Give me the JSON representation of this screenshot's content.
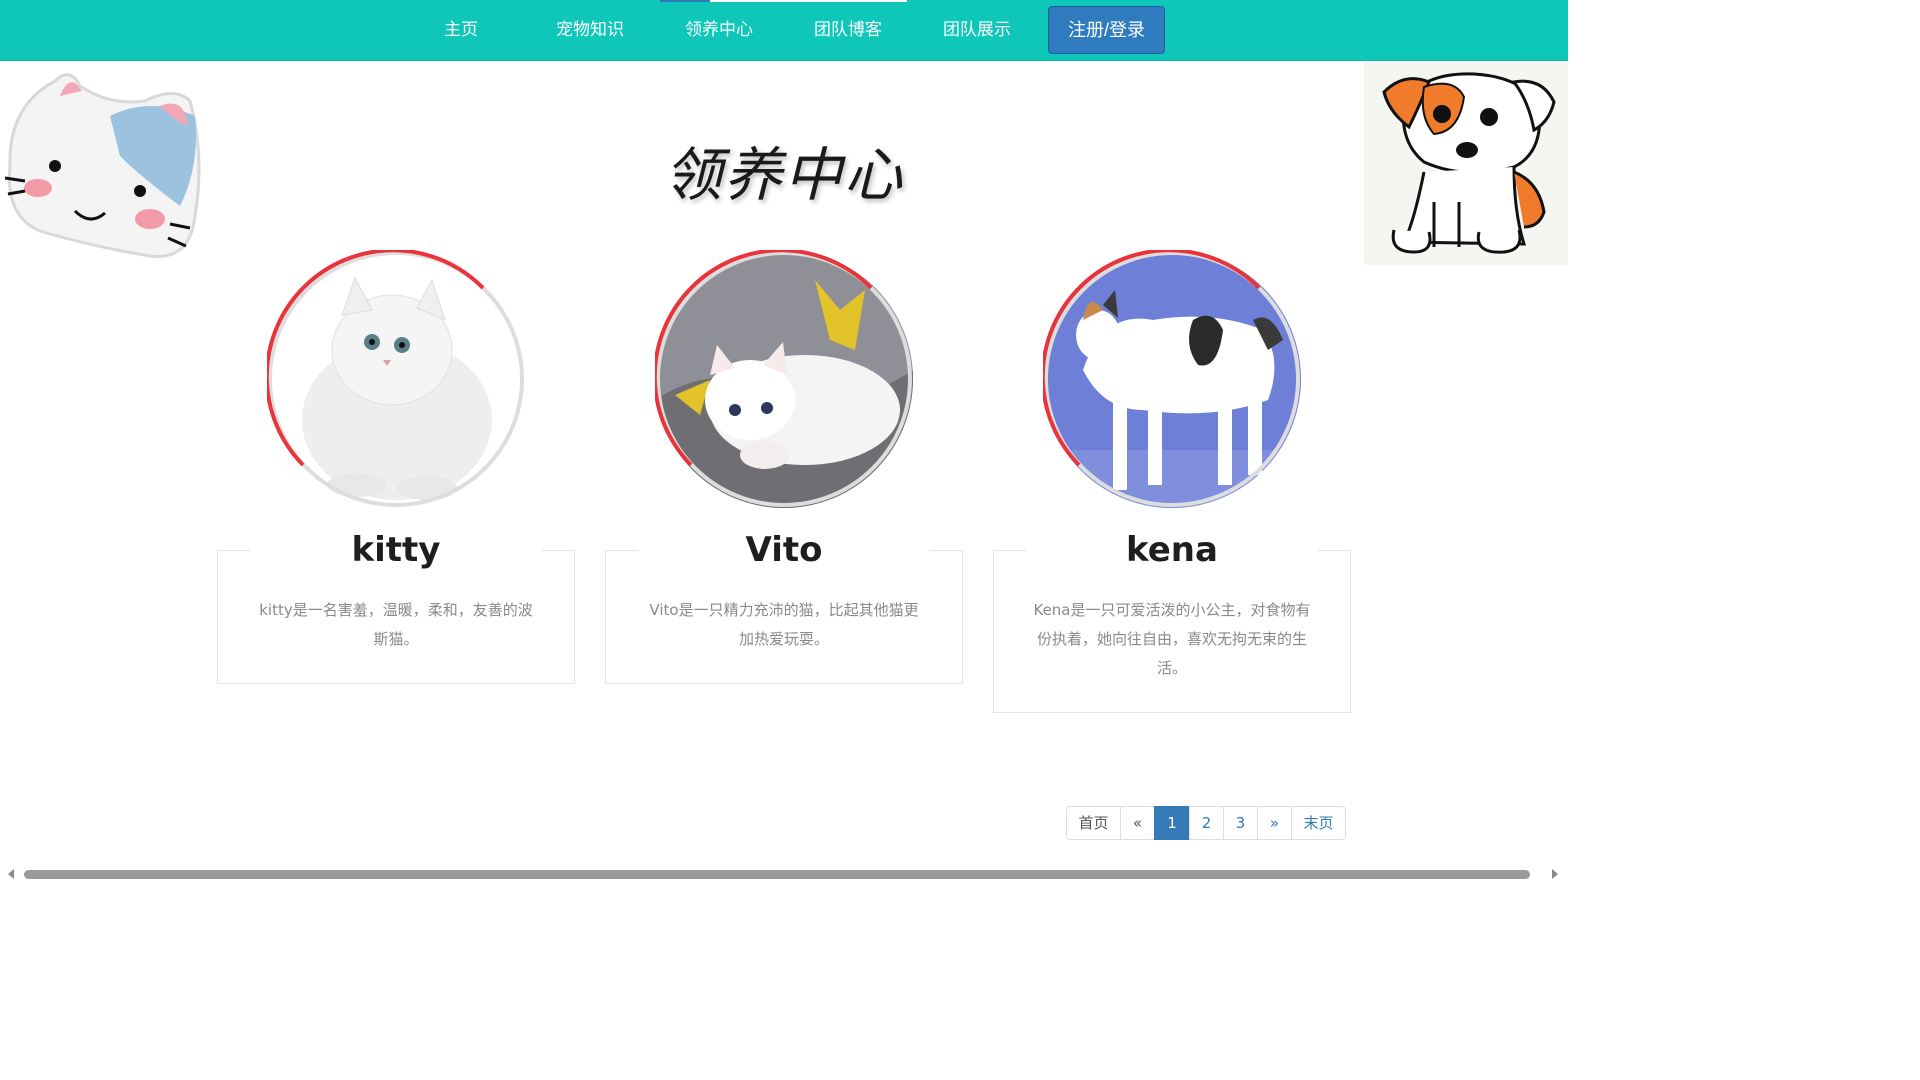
{
  "nav": {
    "items": [
      {
        "label": "主页"
      },
      {
        "label": "宠物知识"
      },
      {
        "label": "领养中心"
      },
      {
        "label": "团队博客"
      },
      {
        "label": "团队展示"
      }
    ],
    "login_label": "注册/登录",
    "colors": {
      "bar": "#0ec7b9",
      "login_button": "#2f7bbf"
    }
  },
  "page_title": "领养中心",
  "pets": [
    {
      "name": "kitty",
      "description": "kitty是一名害羞，温暖，柔和，友善的波斯猫。"
    },
    {
      "name": "Vito",
      "description": "Vito是一只精力充沛的猫，比起其他猫更加热爱玩耍。"
    },
    {
      "name": "kena",
      "description": "Kena是一只可爱活泼的小公主，对食物有份执着，她向往自由，喜欢无拘无束的生活。"
    }
  ],
  "ring_accent": "#e8343a",
  "pagination": {
    "first": "首页",
    "prev": "«",
    "pages": [
      "1",
      "2",
      "3"
    ],
    "current": "1",
    "next": "»",
    "last": "末页"
  }
}
